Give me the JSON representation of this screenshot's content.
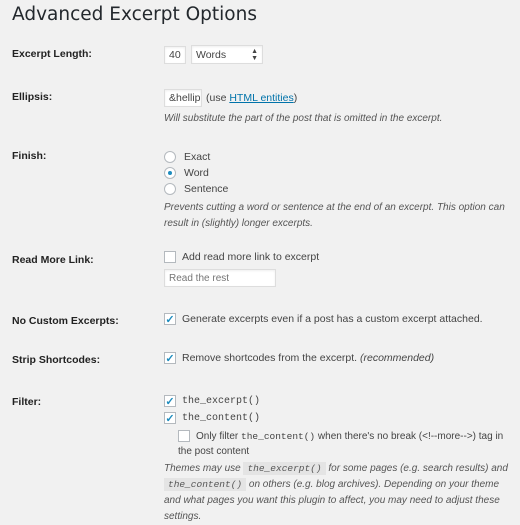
{
  "title": "Advanced Excerpt Options",
  "excerpt_length": {
    "label": "Excerpt Length:",
    "value": "40",
    "unit": "Words"
  },
  "ellipsis": {
    "label": "Ellipsis:",
    "value": "&hellip;",
    "hint_pre": "(use ",
    "hint_link": "HTML entities",
    "hint_post": ")",
    "desc": "Will substitute the part of the post that is omitted in the excerpt."
  },
  "finish": {
    "label": "Finish:",
    "options": [
      {
        "label": "Exact",
        "checked": false
      },
      {
        "label": "Word",
        "checked": true
      },
      {
        "label": "Sentence",
        "checked": false
      }
    ],
    "desc": "Prevents cutting a word or sentence at the end of an excerpt. This option can result in (slightly) longer excerpts."
  },
  "read_more": {
    "label": "Read More Link:",
    "checkbox": "Add read more link to excerpt",
    "checked": false,
    "placeholder": "Read the rest"
  },
  "no_custom": {
    "label": "No Custom Excerpts:",
    "checkbox": "Generate excerpts even if a post has a custom excerpt attached.",
    "checked": true
  },
  "strip": {
    "label": "Strip Shortcodes:",
    "checkbox": "Remove shortcodes from the excerpt.",
    "note": "(recommended)",
    "checked": true
  },
  "filter": {
    "label": "Filter:",
    "opt1": "the_excerpt()",
    "opt2": "the_content()",
    "sub_pre": "Only filter ",
    "sub_code": "the_content()",
    "sub_post": " when there's no break (<!--more-->) tag in",
    "sub_line2": "the post content",
    "desc1": "Themes may use ",
    "desc_code1": "the_excerpt()",
    "desc2": " for some pages (e.g. search results) and ",
    "desc_code2": "the_content()",
    "desc3": " on others (e.g. blog archives). Depending on your theme and what pages you want this plugin to affect, you may need to adjust these settings."
  },
  "colors": {
    "accent": "#1e8cbe",
    "link": "#0073aa",
    "background": "#f1f1f1"
  }
}
